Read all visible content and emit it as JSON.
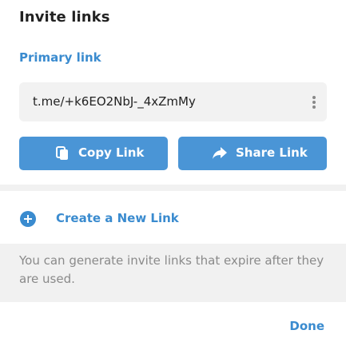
{
  "dialog": {
    "title": "Invite links",
    "section_label": "Primary link",
    "link": {
      "url": "t.me/+k6EO2NbJ-_4xZmMy",
      "menu_icon": "more-vertical-icon"
    },
    "buttons": {
      "copy": {
        "label": "Copy Link",
        "icon": "copy-icon"
      },
      "share": {
        "label": "Share Link",
        "icon": "share-arrow-icon"
      }
    },
    "create": {
      "label": "Create a New Link",
      "icon": "plus-circle-icon"
    },
    "info": "You can generate invite links that expire after they are used.",
    "done_label": "Done"
  },
  "colors": {
    "accent": "#3a8bcf",
    "button_bg": "#4a95d6",
    "panel_bg": "#f1f1f1",
    "link_box_bg": "#f2f2f2"
  }
}
